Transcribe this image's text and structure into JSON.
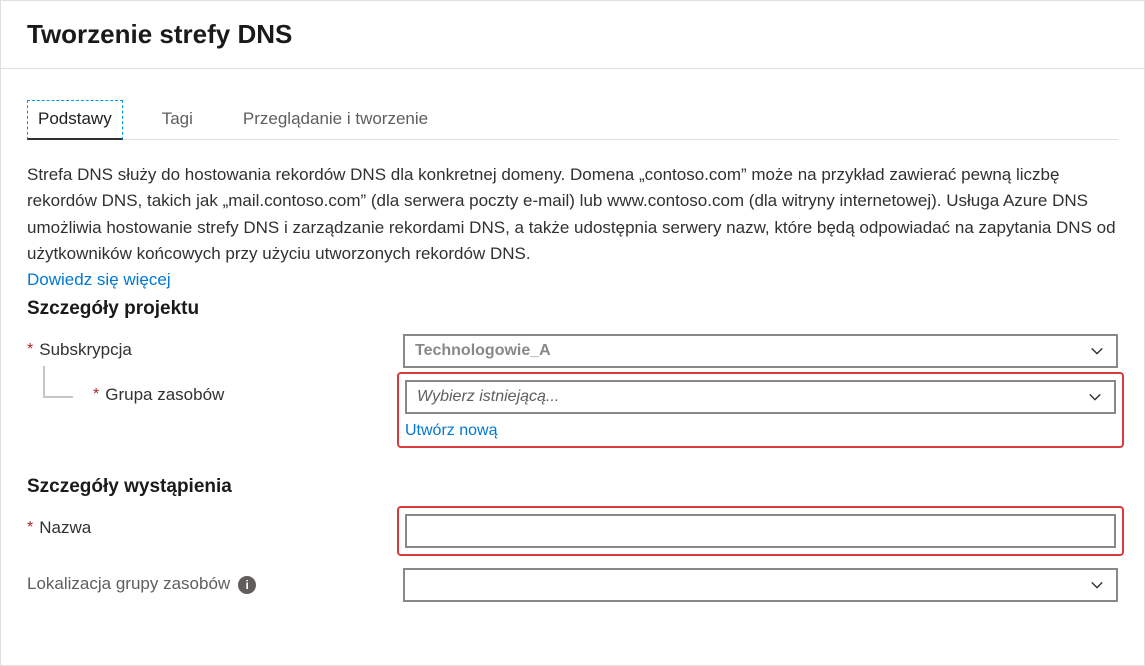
{
  "header": {
    "title": "Tworzenie strefy DNS"
  },
  "tabs": [
    {
      "label": "Podstawy",
      "active": true
    },
    {
      "label": "Tagi",
      "active": false
    },
    {
      "label": "Przeglądanie i tworzenie",
      "active": false
    }
  ],
  "description": "Strefa DNS służy do hostowania rekordów DNS dla konkretnej domeny. Domena „contoso.com” może na przykład zawierać pewną liczbę rekordów DNS, takich jak „mail.contoso.com” (dla serwera poczty e-mail) lub www.contoso.com (dla witryny internetowej). Usługa Azure DNS umożliwia hostowanie strefy DNS i zarządzanie rekordami DNS, a także udostępnia serwery nazw, które będą odpowiadać na zapytania DNS od użytkowników końcowych przy użyciu utworzonych rekordów DNS.",
  "learn_more": "Dowiedz się więcej",
  "sections": {
    "project": {
      "title": "Szczegóły projektu",
      "subscription_label": "Subskrypcja",
      "subscription_value": "Technologowie_A",
      "resource_group_label": "Grupa zasobów",
      "resource_group_placeholder": "Wybierz istniejącą...",
      "create_new": "Utwórz nową"
    },
    "instance": {
      "title": "Szczegóły wystąpienia",
      "name_label": "Nazwa",
      "name_value": "",
      "rg_location_label": "Lokalizacja grupy zasobów",
      "rg_location_value": ""
    }
  },
  "icons": {
    "chevron_down": "chevron-down-icon",
    "info": "info-icon"
  }
}
